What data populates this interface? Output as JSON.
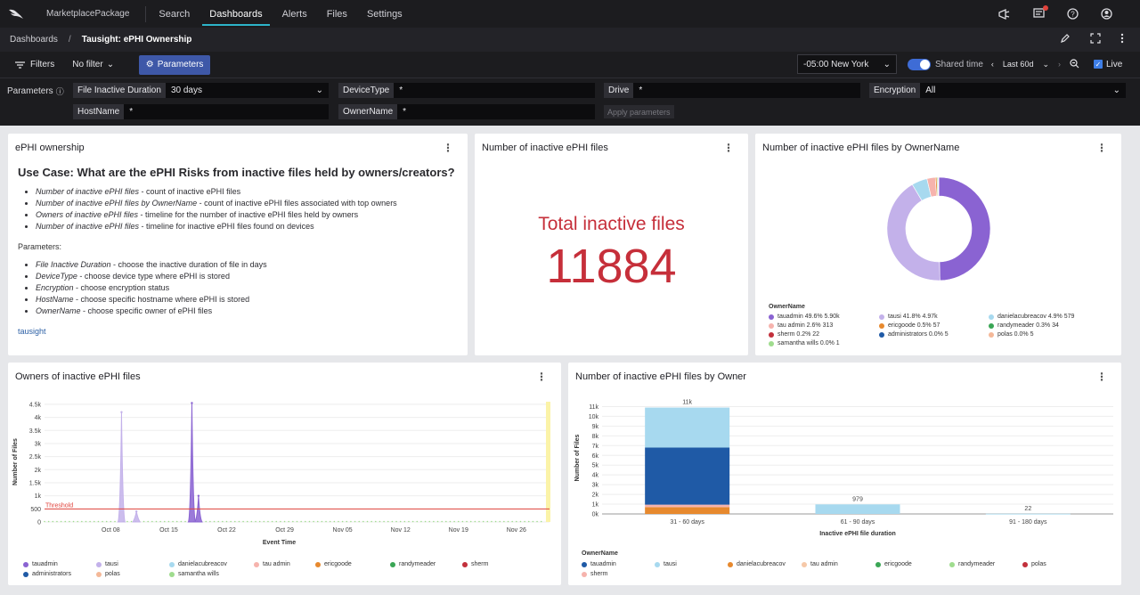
{
  "nav": {
    "app_name": "MarketplacePackage",
    "items": [
      "Search",
      "Dashboards",
      "Alerts",
      "Files",
      "Settings"
    ],
    "active": "Dashboards",
    "icons": [
      "announce-icon",
      "notifications-icon",
      "help-icon",
      "user-icon"
    ]
  },
  "breadcrumb": {
    "root": "Dashboards",
    "sep": "/",
    "current": "Tausight: ePHI Ownership"
  },
  "filterbar": {
    "filters_label": "Filters",
    "no_filter": "No filter",
    "parameters_label": "Parameters",
    "timezone": "-05:00 New York",
    "shared_time": "Shared time",
    "range": "Last 60d",
    "live": "Live"
  },
  "params": {
    "label": "Parameters",
    "fields": [
      {
        "name": "File Inactive Duration",
        "value": "30 days"
      },
      {
        "name": "DeviceType",
        "value": "*"
      },
      {
        "name": "Drive",
        "value": "*"
      },
      {
        "name": "Encryption",
        "value": "All"
      },
      {
        "name": "HostName",
        "value": "*"
      },
      {
        "name": "OwnerName",
        "value": "*"
      }
    ],
    "apply": "Apply parameters"
  },
  "panels": {
    "ownership": {
      "title": "ePHI ownership",
      "heading": "Use Case: What are the ePHI Risks from inactive files held by owners/creators?",
      "items": [
        {
          "em": "Number of inactive ePHI files",
          "text": " - count of inactive ePHI files"
        },
        {
          "em": "Number of inactive ePHI files by OwnerName",
          "text": " - count of inactive ePHI files associated with top owners"
        },
        {
          "em": "Owners of inactive ePHI files",
          "text": " - timeline for the number of inactive ePHI files held by owners"
        },
        {
          "em": "Number of inactive ePHI files",
          "text": " - timeline for inactive ePHI files found on devices"
        }
      ],
      "params_heading": "Parameters:",
      "param_items": [
        {
          "em": "File Inactive Duration",
          "text": " - choose the inactive duration of file in days"
        },
        {
          "em": "DeviceType",
          "text": " - choose device type where ePHI is stored"
        },
        {
          "em": "Encryption",
          "text": " - choose encryption status"
        },
        {
          "em": "HostName",
          "text": " - choose specific hostname where ePHI is stored"
        },
        {
          "em": "OwnerName",
          "text": " - choose specific owner of ePHI files"
        }
      ],
      "link": "tausight"
    },
    "total": {
      "title": "Number of inactive ePHI files",
      "subtitle": "Total inactive files",
      "value": "11884"
    },
    "donut": {
      "title": "Number of inactive ePHI files by OwnerName",
      "legend_title": "OwnerName"
    },
    "timeline": {
      "title": "Owners of inactive ePHI files"
    },
    "bars": {
      "title": "Number of inactive ePHI files by Owner"
    }
  },
  "chart_data": [
    {
      "type": "pie",
      "legend_title": "OwnerName",
      "slices": [
        {
          "name": "tauadmin",
          "pct": 49.6,
          "value": 5900,
          "label": "tauadmin 49.6% 5.90k",
          "color": "#8a63d2"
        },
        {
          "name": "tausi",
          "pct": 41.8,
          "value": 4970,
          "label": "tausi 41.8% 4.97k",
          "color": "#c3b1ea"
        },
        {
          "name": "danielacubreacov",
          "pct": 4.9,
          "value": 579,
          "label": "danielacubreacov 4.9% 579",
          "color": "#a7d9ef"
        },
        {
          "name": "tau admin",
          "pct": 2.6,
          "value": 313,
          "label": "tau admin 2.6% 313",
          "color": "#f6b3ad"
        },
        {
          "name": "ericgoode",
          "pct": 0.5,
          "value": 57,
          "label": "ericgoode 0.5% 57",
          "color": "#e7892e"
        },
        {
          "name": "randymeader",
          "pct": 0.3,
          "value": 34,
          "label": "randymeader 0.3% 34",
          "color": "#3aa655"
        },
        {
          "name": "sherm",
          "pct": 0.2,
          "value": 22,
          "label": "sherm 0.2% 22",
          "color": "#c2303b"
        },
        {
          "name": "administrators",
          "pct": 0.0,
          "value": 5,
          "label": "administrators 0.0% 5",
          "color": "#1f5aa6"
        },
        {
          "name": "polas",
          "pct": 0.0,
          "value": 5,
          "label": "polas 0.0% 5",
          "color": "#f4b898"
        },
        {
          "name": "samantha wills",
          "pct": 0.0,
          "value": 1,
          "label": "samantha wills 0.0% 1",
          "color": "#9fdc8e"
        }
      ]
    },
    {
      "type": "area",
      "xlabel": "Event Time",
      "ylabel": "Number of Files",
      "ylim": [
        0,
        4600
      ],
      "y_ticks": [
        0,
        500,
        1000,
        1500,
        2000,
        2500,
        3000,
        3500,
        4000,
        4500
      ],
      "y_tick_labels": [
        "0",
        "500",
        "1k",
        "1.5k",
        "2k",
        "2.5k",
        "3k",
        "3.5k",
        "4k",
        "4.5k"
      ],
      "x_tick_labels": [
        "Oct 08",
        "Oct 15",
        "Oct 22",
        "Oct 29",
        "Nov 05",
        "Nov 12",
        "Nov 19",
        "Nov 26"
      ],
      "threshold": {
        "label": "Threshold",
        "value": 500,
        "color": "#e0423b"
      },
      "series": [
        {
          "name": "tausi",
          "color": "#c3b1ea",
          "peaks": [
            {
              "day": 9.3,
              "value": 4200
            },
            {
              "day": 11.1,
              "value": 400
            }
          ]
        },
        {
          "name": "tauadmin",
          "color": "#8a63d2",
          "peaks": [
            {
              "day": 17.8,
              "value": 4550
            },
            {
              "day": 18.6,
              "value": 1000
            }
          ]
        }
      ],
      "legend": [
        {
          "name": "tauadmin",
          "color": "#8a63d2"
        },
        {
          "name": "tausi",
          "color": "#c3b1ea"
        },
        {
          "name": "danielacubreacov",
          "color": "#a7d9ef"
        },
        {
          "name": "tau admin",
          "color": "#f6b3ad"
        },
        {
          "name": "ericgoode",
          "color": "#e7892e"
        },
        {
          "name": "randymeader",
          "color": "#3aa655"
        },
        {
          "name": "sherm",
          "color": "#c2303b"
        },
        {
          "name": "administrators",
          "color": "#1f5aa6"
        },
        {
          "name": "polas",
          "color": "#f4b898"
        },
        {
          "name": "samantha wills",
          "color": "#9fdc8e"
        }
      ]
    },
    {
      "type": "bar",
      "xlabel": "Inactive ePHI file duration",
      "ylabel": "Number of Files",
      "ylim": [
        0,
        11500
      ],
      "y_ticks": [
        0,
        1000,
        2000,
        3000,
        4000,
        5000,
        6000,
        7000,
        8000,
        9000,
        10000,
        11000
      ],
      "y_tick_labels": [
        "0k",
        "1k",
        "2k",
        "3k",
        "4k",
        "5k",
        "6k",
        "7k",
        "8k",
        "9k",
        "10k",
        "11k"
      ],
      "categories": [
        "31 - 60 days",
        "61 - 90 days",
        "91 - 180 days"
      ],
      "totals_labels": [
        "11k",
        "979",
        "22"
      ],
      "stacks": [
        [
          {
            "name": "ericgoode",
            "value": 700,
            "color": "#e7892e"
          },
          {
            "name": "tau admin",
            "value": 250,
            "color": "#f6b3ad"
          },
          {
            "name": "tauadmin",
            "value": 5850,
            "color": "#1f5aa6"
          },
          {
            "name": "tausi",
            "value": 4100,
            "color": "#a7d9ef"
          }
        ],
        [
          {
            "name": "tausi",
            "value": 979,
            "color": "#a7d9ef"
          }
        ],
        [
          {
            "name": "tausi",
            "value": 22,
            "color": "#a7d9ef"
          }
        ]
      ],
      "legend_title": "OwnerName",
      "legend": [
        {
          "name": "tauadmin",
          "color": "#1f5aa6"
        },
        {
          "name": "tausi",
          "color": "#a7d9ef"
        },
        {
          "name": "danielacubreacov",
          "color": "#e7892e"
        },
        {
          "name": "tau admin",
          "color": "#f6c8a8"
        },
        {
          "name": "ericgoode",
          "color": "#3aa655"
        },
        {
          "name": "randymeader",
          "color": "#9fdc8e"
        },
        {
          "name": "polas",
          "color": "#c2303b"
        },
        {
          "name": "sherm",
          "color": "#f6b3ad"
        }
      ]
    }
  ]
}
